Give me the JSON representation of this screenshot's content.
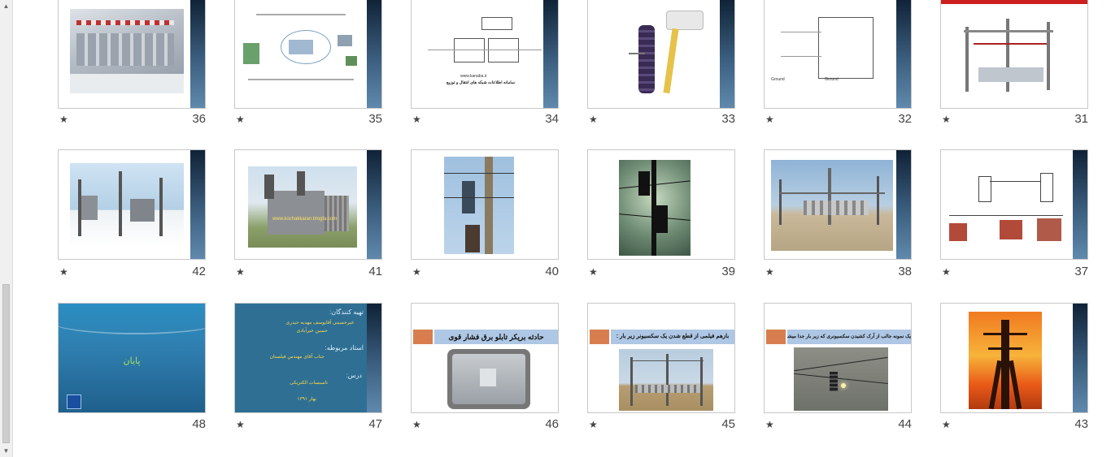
{
  "scrollbar": {
    "up_glyph": "▲",
    "down_glyph": "▼"
  },
  "slides": [
    {
      "number": "36",
      "star": "★"
    },
    {
      "number": "35",
      "star": "★"
    },
    {
      "number": "34",
      "star": "★"
    },
    {
      "number": "33",
      "star": "★"
    },
    {
      "number": "32",
      "star": "★"
    },
    {
      "number": "31",
      "star": "★"
    },
    {
      "number": "42",
      "star": "★"
    },
    {
      "number": "41",
      "star": "★"
    },
    {
      "number": "40",
      "star": "★"
    },
    {
      "number": "39",
      "star": "★"
    },
    {
      "number": "38",
      "star": "★"
    },
    {
      "number": "37",
      "star": "★"
    },
    {
      "number": "48",
      "star": ""
    },
    {
      "number": "47",
      "star": "★"
    },
    {
      "number": "46",
      "star": "★"
    },
    {
      "number": "45",
      "star": "★"
    },
    {
      "number": "44",
      "star": "★"
    },
    {
      "number": "43",
      "star": "★"
    }
  ],
  "slide_texts": {
    "s34_caption": "www.kanaba.ir",
    "s34_title": "سامانه اطلاعات شبکه های انتقال و توزیع",
    "s32_ground": "Ground",
    "s41_watermark": "www.kochakkaran.blogfa.com",
    "s48_title": "پایان",
    "s47_prepared": "تهیه کنندگان:",
    "s47_names1": "غیرحسینی آقایوسف    مهدیه حیدری",
    "s47_names2": "حسین خیرآبادی",
    "s47_teacher_label": "استاد مربوطه:",
    "s47_teacher": "جناب آقای مهندس فیلستان",
    "s47_course_label": "درس:",
    "s47_course": "تاسیسات الکتریکی",
    "s47_date": "بهار ۱۳۹۱",
    "s46_title": "حادثه بریکر تابلو برق فشار قوی",
    "s45_title": "بازهم فیلمی از قطع شدن یک سکسیونر زیر بار :",
    "s44_title": "یک نمونه جالب از آرک کشیدن سکسیونری که زیر بار جدا میشود"
  },
  "colors": {
    "slide_bar_dark": "#0f2236",
    "slide_bar_light": "#5f89ad",
    "title_band": "#aec7e4",
    "accent_orange": "#d87e4e",
    "theme_blue": "#2a74a0",
    "gold_text": "#ffd84a",
    "green_text": "#a8e05a"
  }
}
